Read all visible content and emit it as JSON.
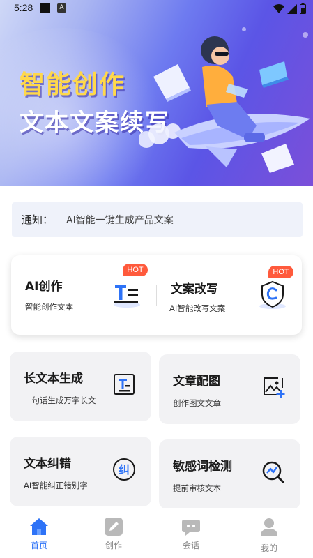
{
  "status_bar": {
    "time": "5:28",
    "notification_badge": "A"
  },
  "banner": {
    "title_line1": "智能创作",
    "title_line2": "文本文案续写"
  },
  "notice": {
    "label": "通知：",
    "text": "AI智能一键生成产品文案"
  },
  "featured": [
    {
      "title": "AI创作",
      "subtitle": "智能创作文本",
      "badge": "HOT",
      "icon": "text-format-icon"
    },
    {
      "title": "文案改写",
      "subtitle": "AI智能改写文案",
      "badge": "HOT",
      "icon": "shield-c-icon"
    }
  ],
  "cards": [
    {
      "title": "长文本生成",
      "subtitle": "一句话生成万字长文",
      "icon": "long-text-icon"
    },
    {
      "title": "文章配图",
      "subtitle": "创作图文文章",
      "icon": "add-image-icon"
    },
    {
      "title": "文本纠错",
      "subtitle": "AI智能纠正错别字",
      "icon": "correct-icon",
      "icon_char": "纠"
    },
    {
      "title": "敏感词检测",
      "subtitle": "提前审核文本",
      "icon": "detect-icon"
    }
  ],
  "tabs": [
    {
      "label": "首页",
      "icon": "home-icon",
      "active": true
    },
    {
      "label": "创作",
      "icon": "pencil-icon",
      "active": false
    },
    {
      "label": "会话",
      "icon": "chat-icon",
      "active": false
    },
    {
      "label": "我的",
      "icon": "user-icon",
      "active": false
    }
  ],
  "colors": {
    "accent": "#2e73f7",
    "hot": "#ff5a3c",
    "inactive": "#b9b9b9"
  }
}
